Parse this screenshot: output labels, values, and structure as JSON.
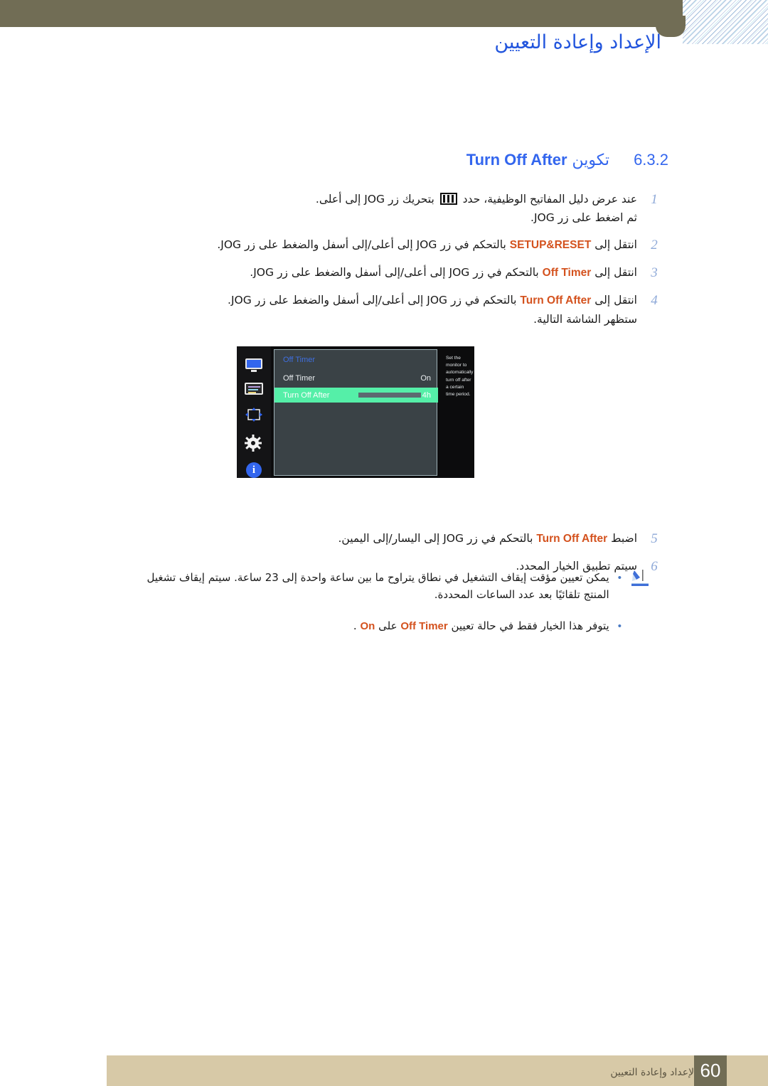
{
  "header": {
    "title": "الإعداد وإعادة التعيين"
  },
  "section": {
    "number": "6.3.2",
    "name_ar": "تكوين",
    "name_en": "Turn Off After"
  },
  "steps": [
    {
      "num": "1",
      "before_icon": "عند عرض دليل المفاتيح الوظيفية، حدد",
      "icon": "osd-menu-icon",
      "after_icon": "بتحريك زر JOG إلى أعلى.",
      "sub": "ثم اضغط على زر JOG."
    },
    {
      "num": "2",
      "text_start": "انتقل إلى",
      "keyword": "SETUP&RESET",
      "text_end": "بالتحكم في زر JOG إلى أعلى/إلى أسفل والضغط على زر JOG.",
      "sub": ""
    },
    {
      "num": "3",
      "text_start": "انتقل إلى",
      "keyword": "Off Timer",
      "text_end": "بالتحكم في زر JOG إلى أعلى/إلى أسفل والضغط على زر JOG.",
      "sub": ""
    },
    {
      "num": "4",
      "text_start": "انتقل إلى",
      "keyword": "Turn Off After",
      "text_end": "بالتحكم في زر JOG إلى أعلى/إلى أسفل والضغط على زر JOG.",
      "sub": "ستظهر الشاشة التالية."
    }
  ],
  "steps2": [
    {
      "num": "5",
      "text_start": "اضبط",
      "keyword": "Turn Off After",
      "text_end": "بالتحكم في زر JOG إلى اليسار/إلى اليمين.",
      "sub": ""
    },
    {
      "num": "6",
      "text_start": "سيتم تطبيق الخيار المحدد.",
      "keyword": "",
      "text_end": "",
      "sub": ""
    }
  ],
  "notes": [
    {
      "bullet": "•",
      "text": "يمكن تعيين مؤقت إيقاف التشغيل في نطاق يتراوح ما بين ساعة واحدة إلى 23 ساعة. سيتم إيقاف تشغيل المنتج تلقائيًا بعد عدد الساعات المحددة.",
      "has_pencil": true
    },
    {
      "bullet": "•",
      "text_start": "يتوفر هذا الخيار فقط في حالة تعيين",
      "keyword": "Off Timer",
      "text_mid": "على",
      "keyword2": "On",
      "text_end": ".",
      "has_pencil": false
    }
  ],
  "osd": {
    "header": "Off Timer",
    "rail_icons": [
      "monitor-icon",
      "picture-icon",
      "move-arrows-icon",
      "gear-icon",
      "info-icon"
    ],
    "rows": [
      {
        "label": "Off Timer",
        "value": "On",
        "selected": false,
        "has_slider": false
      },
      {
        "label": "Turn Off After",
        "value": "4h",
        "selected": true,
        "has_slider": true,
        "slider_percent": 25
      }
    ],
    "help_text": "Set the monitor to automatically turn off after a certain time period."
  },
  "footer": {
    "text": "الإعداد وإعادة التعيين",
    "page": "60"
  },
  "colors": {
    "header_band": "#716d55",
    "title_blue": "#2255dd",
    "keyword_orange": "#d4521e",
    "osd_highlight": "#55efa8",
    "footer_bar": "#d7c9a7"
  }
}
